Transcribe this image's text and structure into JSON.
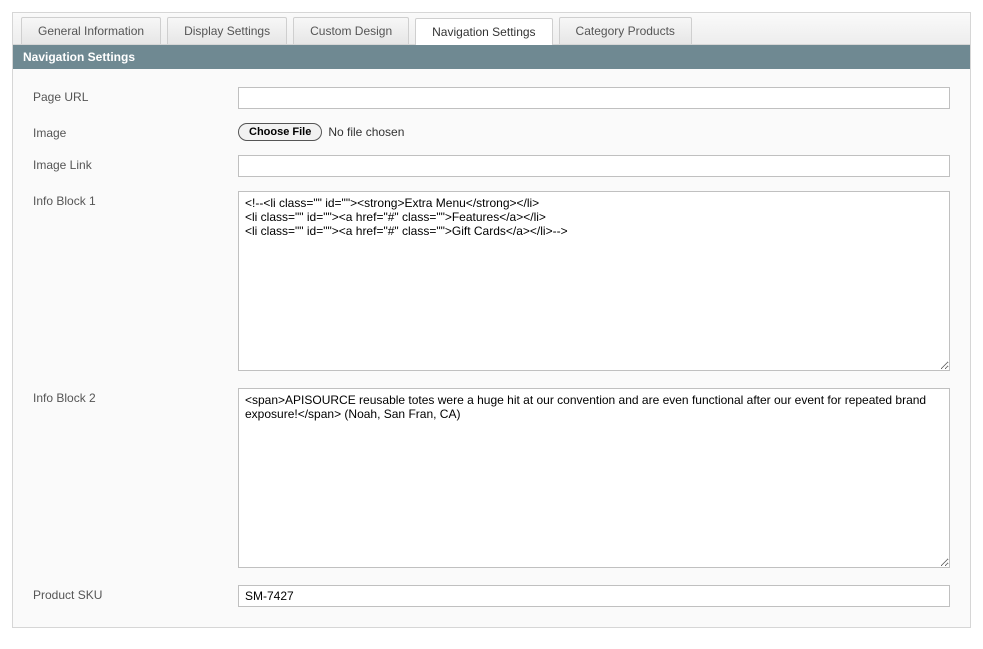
{
  "tabs": [
    {
      "label": "General Information",
      "active": false
    },
    {
      "label": "Display Settings",
      "active": false
    },
    {
      "label": "Custom Design",
      "active": false
    },
    {
      "label": "Navigation Settings",
      "active": true
    },
    {
      "label": "Category Products",
      "active": false
    }
  ],
  "panel": {
    "title": "Navigation Settings"
  },
  "form": {
    "page_url": {
      "label": "Page URL",
      "value": ""
    },
    "image": {
      "label": "Image",
      "button": "Choose File",
      "status": "No file chosen"
    },
    "image_link": {
      "label": "Image Link",
      "value": ""
    },
    "info_block_1": {
      "label": "Info Block 1",
      "value": "<!--<li class=\"\" id=\"\"><strong>Extra Menu</strong></li>\n<li class=\"\" id=\"\"><a href=\"#\" class=\"\">Features</a></li>\n<li class=\"\" id=\"\"><a href=\"#\" class=\"\">Gift Cards</a></li>-->"
    },
    "info_block_2": {
      "label": "Info Block 2",
      "value": "<span>APISOURCE reusable totes were a huge hit at our convention and are even functional after our event for repeated brand exposure!</span> (Noah, San Fran, CA)"
    },
    "product_sku": {
      "label": "Product SKU",
      "value": "SM-7427"
    }
  }
}
